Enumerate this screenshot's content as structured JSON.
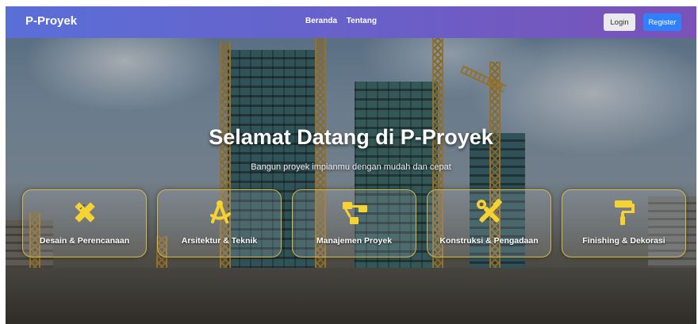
{
  "navbar": {
    "brand": "P-Proyek",
    "links": [
      "Beranda",
      "Tentang"
    ],
    "login_label": "Login",
    "register_label": "Register"
  },
  "hero": {
    "title": "Selamat Datang di P-Proyek",
    "subtitle": "Bangun proyek impianmu dengan mudah dan cepat"
  },
  "services": [
    {
      "label": "Desain & Perencanaan",
      "icon": "pencil-ruler-icon"
    },
    {
      "label": "Arsitektur & Teknik",
      "icon": "compass-drafting-icon"
    },
    {
      "label": "Manajemen Proyek",
      "icon": "project-diagram-icon"
    },
    {
      "label": "Konstruksi & Pengadaan",
      "icon": "tools-icon"
    },
    {
      "label": "Finishing & Dekorasi",
      "icon": "paint-roller-icon"
    }
  ],
  "colors": {
    "icon": "#f6d232",
    "card_border": "#d9b84a",
    "register_button": "#2f80ff",
    "navbar_start": "#5a6fd8",
    "navbar_end": "#7a52b8"
  }
}
